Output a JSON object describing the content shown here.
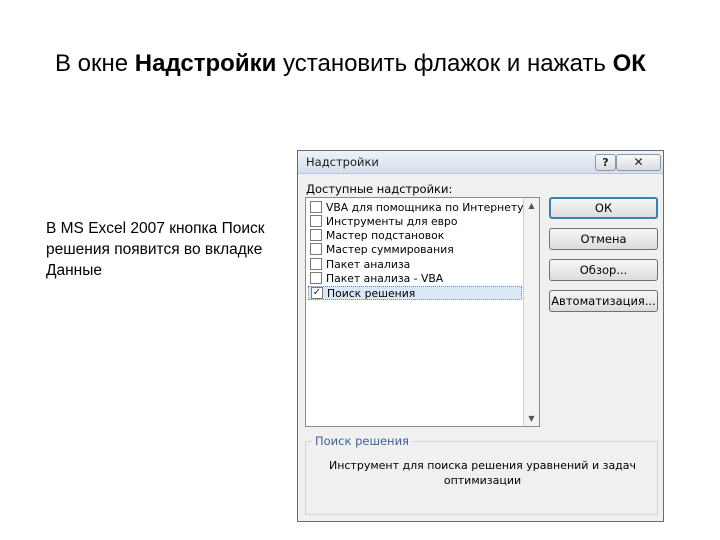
{
  "slide": {
    "title_part1": "В окне ",
    "title_bold1": "Надстройки",
    "title_part2": " установить флажок и нажать ",
    "title_bold2": "ОК",
    "note": "В MS Excel 2007 кнопка Поиск решения появится во вкладке Данные"
  },
  "dialog": {
    "title": "Надстройки",
    "help_symbol": "?",
    "close_symbol": "✕",
    "available_label": "Доступные надстройки:",
    "addins": [
      {
        "label": "VBA для помощника по Интернету",
        "checked": false
      },
      {
        "label": "Инструменты для евро",
        "checked": false
      },
      {
        "label": "Мастер подстановок",
        "checked": false
      },
      {
        "label": "Мастер суммирования",
        "checked": false
      },
      {
        "label": "Пакет анализа",
        "checked": false
      },
      {
        "label": "Пакет анализа - VBA",
        "checked": false
      },
      {
        "label": "Поиск решения",
        "checked": true
      }
    ],
    "buttons": {
      "ok": "ОК",
      "cancel": "Отмена",
      "browse": "Обзор...",
      "automation": "Автоматизация..."
    },
    "group_label": "Поиск решения",
    "group_description": "Инструмент для поиска решения уравнений и задач оптимизации"
  }
}
